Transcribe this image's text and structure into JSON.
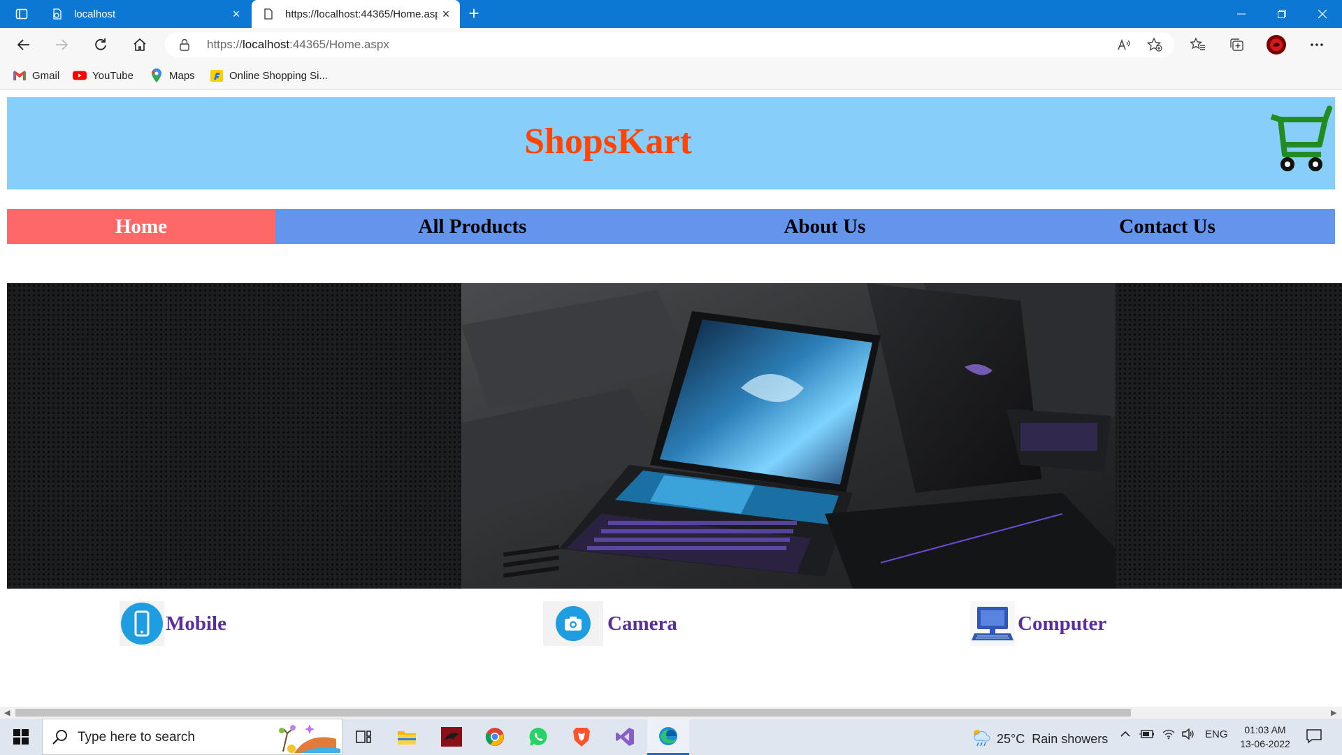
{
  "browser": {
    "tabs": [
      {
        "title": "localhost"
      },
      {
        "title": "https://localhost:44365/Home.aspx"
      }
    ],
    "address": {
      "prefix": "https://",
      "host": "localhost",
      "rest": ":44365/Home.aspx"
    },
    "bookmarks": [
      {
        "label": "Gmail",
        "icon": "gmail-icon"
      },
      {
        "label": "YouTube",
        "icon": "youtube-icon"
      },
      {
        "label": "Maps",
        "icon": "maps-icon"
      },
      {
        "label": "Online Shopping Si...",
        "icon": "flipkart-icon"
      }
    ]
  },
  "site": {
    "brand": "ShopsKart",
    "menu": [
      {
        "label": "Home",
        "active": true
      },
      {
        "label": "All Products"
      },
      {
        "label": "About Us"
      },
      {
        "label": "Contact Us"
      }
    ],
    "categories": [
      {
        "label": "Mobile",
        "icon": "mobile-icon"
      },
      {
        "label": "Camera",
        "icon": "camera-icon"
      },
      {
        "label": "Computer",
        "icon": "computer-icon"
      }
    ],
    "colors": {
      "header": "#87cefa",
      "brand": "#ff4500",
      "menu": "#6495ed",
      "menu_active": "#ff6868",
      "category_text": "#5a2ea0",
      "cart": "#228b22"
    }
  },
  "taskbar": {
    "search_placeholder": "Type here to search",
    "weather": {
      "temp": "25°C",
      "condition": "Rain showers"
    },
    "language": "ENG",
    "time": "01:03 AM",
    "date": "13-06-2022"
  }
}
